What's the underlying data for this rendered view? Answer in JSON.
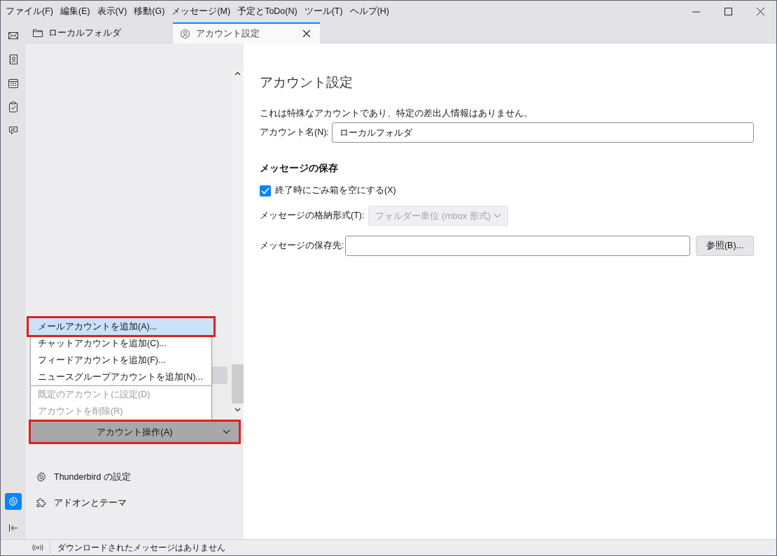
{
  "menu_bar": [
    "ファイル(F)",
    "編集(E)",
    "表示(V)",
    "移動(G)",
    "メッセージ(M)",
    "予定とToDo(N)",
    "ツール(T)",
    "ヘルプ(H)"
  ],
  "spaces_toolbar": [
    {
      "kind": "mail"
    },
    {
      "kind": "contacts"
    },
    {
      "kind": "calendar"
    },
    {
      "kind": "tasks"
    },
    {
      "kind": "chat"
    }
  ],
  "spaces_settings": {
    "selected": true
  },
  "tabs": [
    {
      "kind": "folder",
      "label": "ローカルフォルダ",
      "selected": false
    },
    {
      "kind": "account",
      "label": "アカウント設定",
      "selected": true
    }
  ],
  "account_actions": {
    "button": "アカウント操作(A)",
    "groups": [
      [
        {
          "label": "メールアカウントを追加(A)...",
          "selected": true,
          "disabled": false
        },
        {
          "label": "チャットアカウントを追加(C)...",
          "selected": false,
          "disabled": false
        },
        {
          "label": "フィードアカウントを追加(F)...",
          "selected": false,
          "disabled": false
        },
        {
          "label": "ニュースグループアカウントを追加(N)...",
          "selected": false,
          "disabled": false
        }
      ],
      [
        {
          "label": "既定のアカウントに設定(D)",
          "selected": false,
          "disabled": true
        },
        {
          "label": "アカウントを削除(R)",
          "selected": false,
          "disabled": true
        }
      ]
    ]
  },
  "sidebar_links": [
    {
      "kind": "settings",
      "label": "Thunderbird の設定"
    },
    {
      "kind": "addons",
      "label": "アドオンとテーマ"
    }
  ],
  "settings": {
    "title": "アカウント設定",
    "description": "これは特殊なアカウントであり、特定の差出人情報はありません。",
    "account_name_label": "アカウント名(N):",
    "account_name_value": "ローカルフォルダ",
    "section_title": "メッセージの保存",
    "empty_trash": {
      "label": "終了時にごみ箱を空にする(X)",
      "checked": true
    },
    "storage_format": {
      "label": "メッセージの格納形式(T):",
      "value": "フォルダー単位 (mbox 形式)",
      "disabled": true
    },
    "location": {
      "label": "メッセージの保存先:"
    },
    "browse_button": "参照(B)..."
  },
  "status_bar": {
    "text": "ダウンロードされたメッセージはありません"
  }
}
